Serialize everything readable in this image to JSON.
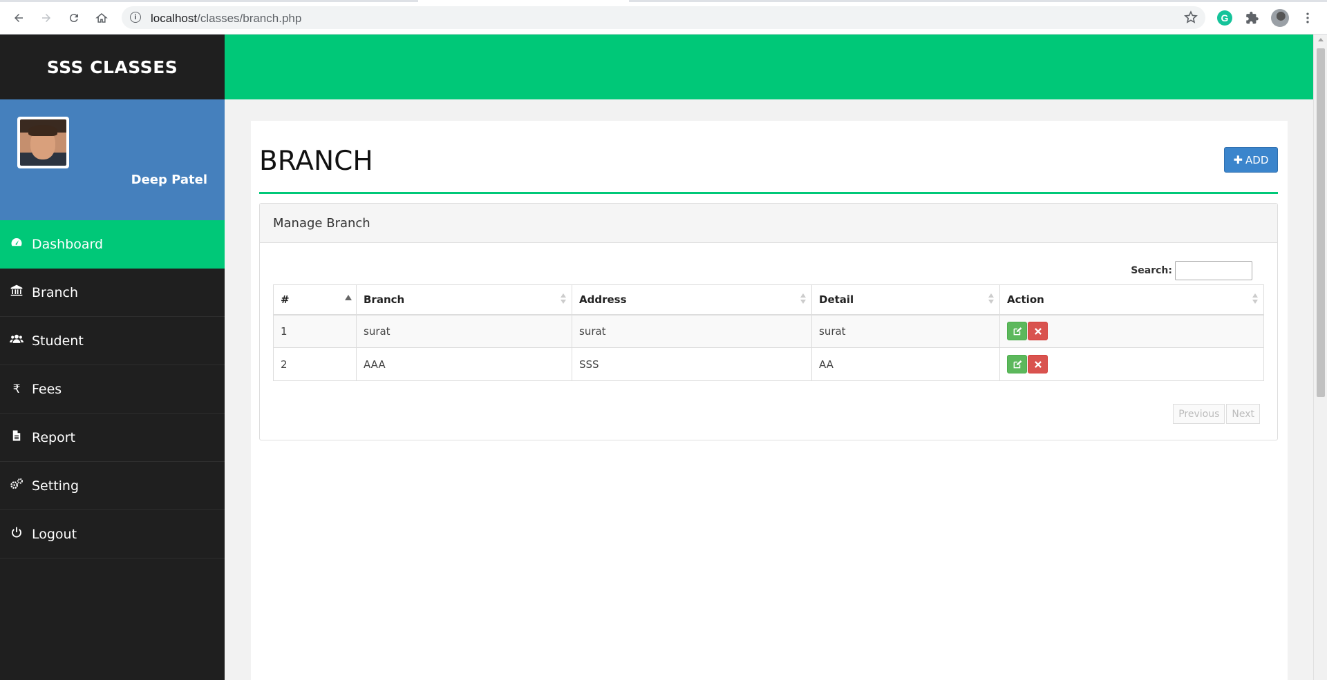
{
  "browser": {
    "url_host": "localhost",
    "url_path": "/classes/branch.php"
  },
  "sidebar": {
    "brand": "SSS CLASSES",
    "user_name": "Deep Patel",
    "items": [
      {
        "label": "Dashboard",
        "icon": "dashboard-icon",
        "active": true
      },
      {
        "label": "Branch",
        "icon": "bank-icon"
      },
      {
        "label": "Student",
        "icon": "users-icon"
      },
      {
        "label": "Fees",
        "icon": "rupee-icon"
      },
      {
        "label": "Report",
        "icon": "file-icon"
      },
      {
        "label": "Setting",
        "icon": "gears-icon"
      },
      {
        "label": "Logout",
        "icon": "power-icon"
      }
    ]
  },
  "main": {
    "title": "BRANCH",
    "add_label": "ADD",
    "panel_title": "Manage Branch",
    "search_label": "Search:",
    "search_value": "",
    "columns": [
      "#",
      "Branch",
      "Address",
      "Detail",
      "Action"
    ],
    "rows": [
      [
        "1",
        "surat",
        "surat",
        "surat"
      ],
      [
        "2",
        "AAA",
        "SSS",
        "AA"
      ]
    ],
    "pager": {
      "prev": "Previous",
      "next": "Next"
    }
  },
  "colors": {
    "accent_green": "#00c878",
    "sidebar_dark": "#1f1f1f",
    "profile_blue": "#4580bd",
    "button_blue": "#3b85cc",
    "edit_green": "#5cb85c",
    "delete_red": "#d9534f"
  }
}
